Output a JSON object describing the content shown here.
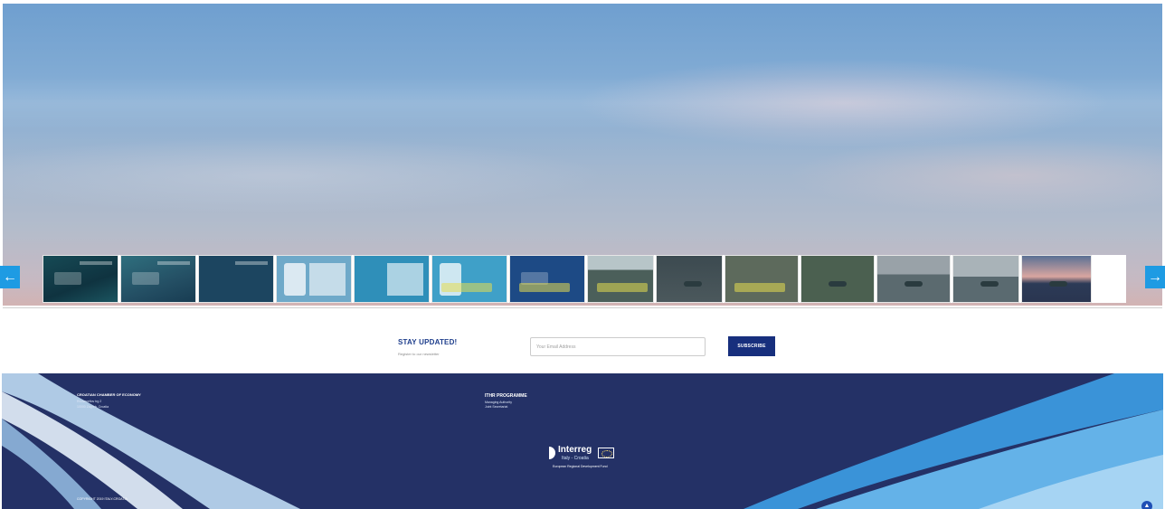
{
  "gallery": {
    "prev_arrow": "←",
    "next_arrow": "→",
    "thumbnails": [
      {
        "icon": "underwater-diver-photo"
      },
      {
        "icon": "underwater-scene-photo"
      },
      {
        "icon": "presentation-slide-photo"
      },
      {
        "icon": "infographic-photo"
      },
      {
        "icon": "poster-photo"
      },
      {
        "icon": "poster-photo"
      },
      {
        "icon": "presentation-slide-photo"
      },
      {
        "icon": "harbour-photo"
      },
      {
        "icon": "sea-boat-photo"
      },
      {
        "icon": "kayak-photo"
      },
      {
        "icon": "kayak-photo"
      },
      {
        "icon": "sailboat-photo"
      },
      {
        "icon": "harbour-people-photo"
      },
      {
        "icon": "sunset-sea-photo"
      }
    ]
  },
  "newsletter": {
    "title": "STAY UPDATED!",
    "subtitle": "Register to our newsletter",
    "email_placeholder": "Your Email Address",
    "subscribe_label": "SUBSCRIBE"
  },
  "footer": {
    "col1": {
      "org": "CROATIAN CHAMBER OF ECONOMY",
      "lines": [
        "Rooseveltov trg 2",
        "10000 Zagreb, Croatia"
      ]
    },
    "col2": {
      "org": "ITHR PROGRAMME",
      "lines": [
        "Managing Authority",
        "Joint Secretariat"
      ]
    },
    "logo": {
      "name": "Interreg",
      "sub": "Italy - Croatia",
      "fund": "European Regional Development Fund"
    },
    "copyright": "COPYRIGHT 2019 ITALY-CROATIA",
    "back_to_top": "▲"
  },
  "colors": {
    "accent": "#1e9be3",
    "footer_bg": "#243166",
    "button_bg": "#172f7d",
    "title": "#1e3e8c"
  }
}
